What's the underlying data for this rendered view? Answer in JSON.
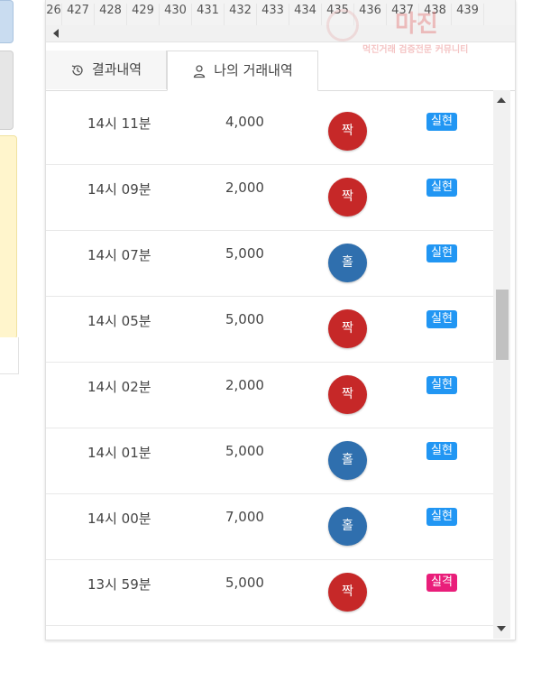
{
  "number_strip": [
    "26",
    "427",
    "428",
    "429",
    "430",
    "431",
    "432",
    "433",
    "434",
    "435",
    "436",
    "437",
    "438",
    "439"
  ],
  "tabs": [
    {
      "label": "결과내역",
      "icon": "history-icon",
      "active": false
    },
    {
      "label": "나의 거래내역",
      "icon": "user-icon",
      "active": true
    }
  ],
  "trades": [
    {
      "time": "14시 11분",
      "amount": "4,000",
      "pick": "짝",
      "pick_color": "#c62828",
      "result": "실현",
      "result_color": "#2196f3"
    },
    {
      "time": "14시 09분",
      "amount": "2,000",
      "pick": "짝",
      "pick_color": "#c62828",
      "result": "실현",
      "result_color": "#2196f3"
    },
    {
      "time": "14시 07분",
      "amount": "5,000",
      "pick": "홀",
      "pick_color": "#2f6fae",
      "result": "실현",
      "result_color": "#2196f3"
    },
    {
      "time": "14시 05분",
      "amount": "5,000",
      "pick": "짝",
      "pick_color": "#c62828",
      "result": "실현",
      "result_color": "#2196f3"
    },
    {
      "time": "14시 02분",
      "amount": "2,000",
      "pick": "짝",
      "pick_color": "#c62828",
      "result": "실현",
      "result_color": "#2196f3"
    },
    {
      "time": "14시 01분",
      "amount": "5,000",
      "pick": "홀",
      "pick_color": "#2f6fae",
      "result": "실현",
      "result_color": "#2196f3"
    },
    {
      "time": "14시 00분",
      "amount": "7,000",
      "pick": "홀",
      "pick_color": "#2f6fae",
      "result": "실현",
      "result_color": "#2196f3"
    },
    {
      "time": "13시 59분",
      "amount": "5,000",
      "pick": "짝",
      "pick_color": "#c62828",
      "result": "실격",
      "result_color": "#e91e7a"
    }
  ],
  "watermark": {
    "title": "마진",
    "subtitle": "먹진거래 검증전문 커뮤니티"
  }
}
